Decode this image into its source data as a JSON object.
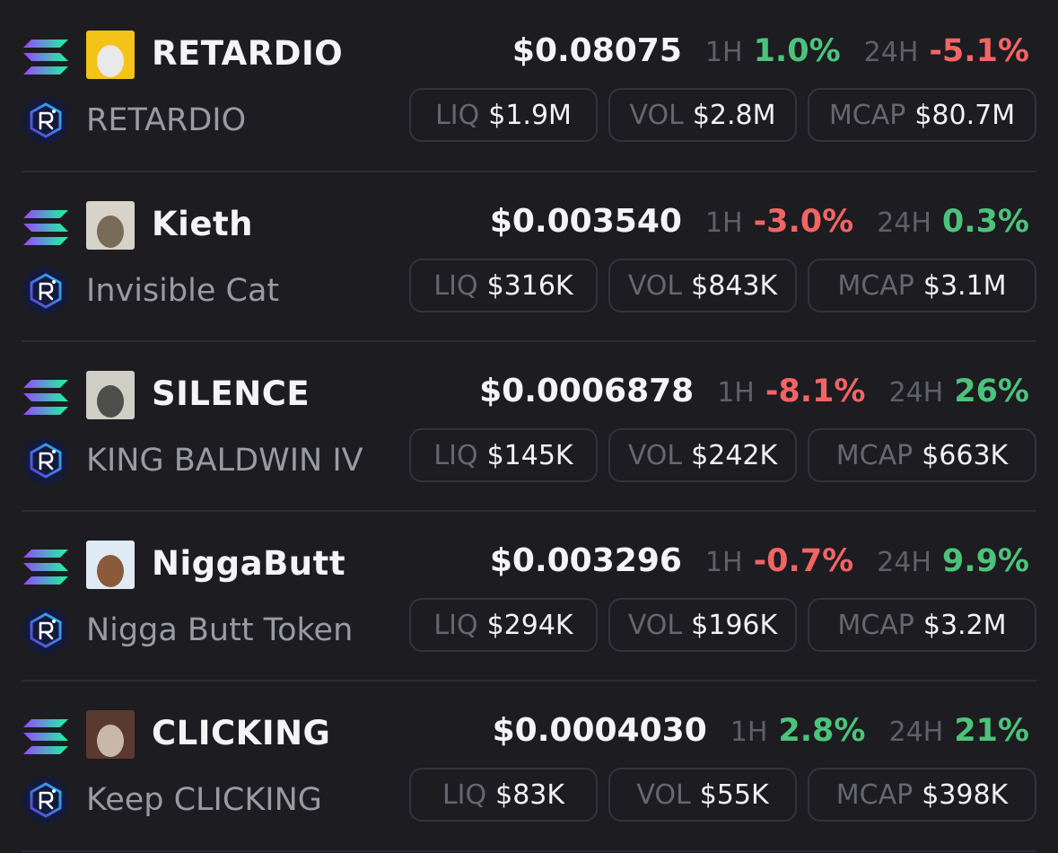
{
  "colors": {
    "background": "#1c1c21",
    "positive": "#4cc37a",
    "negative": "#f36464",
    "muted": "#66666e",
    "divider": "#2c2c33"
  },
  "icons": {
    "chain": "solana-logo-icon",
    "dex": "raydium-logo-icon"
  },
  "labels": {
    "h1": "1H",
    "h24": "24H",
    "liq": "LIQ",
    "vol": "VOL",
    "mcap": "MCAP"
  },
  "tokens": [
    {
      "symbol": "RETARDIO",
      "name": "RETARDIO",
      "price": "$0.08075",
      "change_1h": "1.0%",
      "change_1h_dir": "pos",
      "change_24h": "-5.1%",
      "change_24h_dir": "neg",
      "liq": "$1.9M",
      "vol": "$2.8M",
      "mcap": "$80.7M"
    },
    {
      "symbol": "Kieth",
      "name": "Invisible Cat",
      "price": "$0.003540",
      "change_1h": "-3.0%",
      "change_1h_dir": "neg",
      "change_24h": "0.3%",
      "change_24h_dir": "pos",
      "liq": "$316K",
      "vol": "$843K",
      "mcap": "$3.1M"
    },
    {
      "symbol": "SILENCE",
      "name": "KING BALDWIN IV",
      "price": "$0.0006878",
      "change_1h": "-8.1%",
      "change_1h_dir": "neg",
      "change_24h": "26%",
      "change_24h_dir": "pos",
      "liq": "$145K",
      "vol": "$242K",
      "mcap": "$663K"
    },
    {
      "symbol": "NiggaButt",
      "name": "Nigga Butt Token",
      "price": "$0.003296",
      "change_1h": "-0.7%",
      "change_1h_dir": "neg",
      "change_24h": "9.9%",
      "change_24h_dir": "pos",
      "liq": "$294K",
      "vol": "$196K",
      "mcap": "$3.2M"
    },
    {
      "symbol": "CLICKING",
      "name": "Keep CLICKING",
      "price": "$0.0004030",
      "change_1h": "2.8%",
      "change_1h_dir": "pos",
      "change_24h": "21%",
      "change_24h_dir": "pos",
      "liq": "$83K",
      "vol": "$55K",
      "mcap": "$398K"
    }
  ]
}
